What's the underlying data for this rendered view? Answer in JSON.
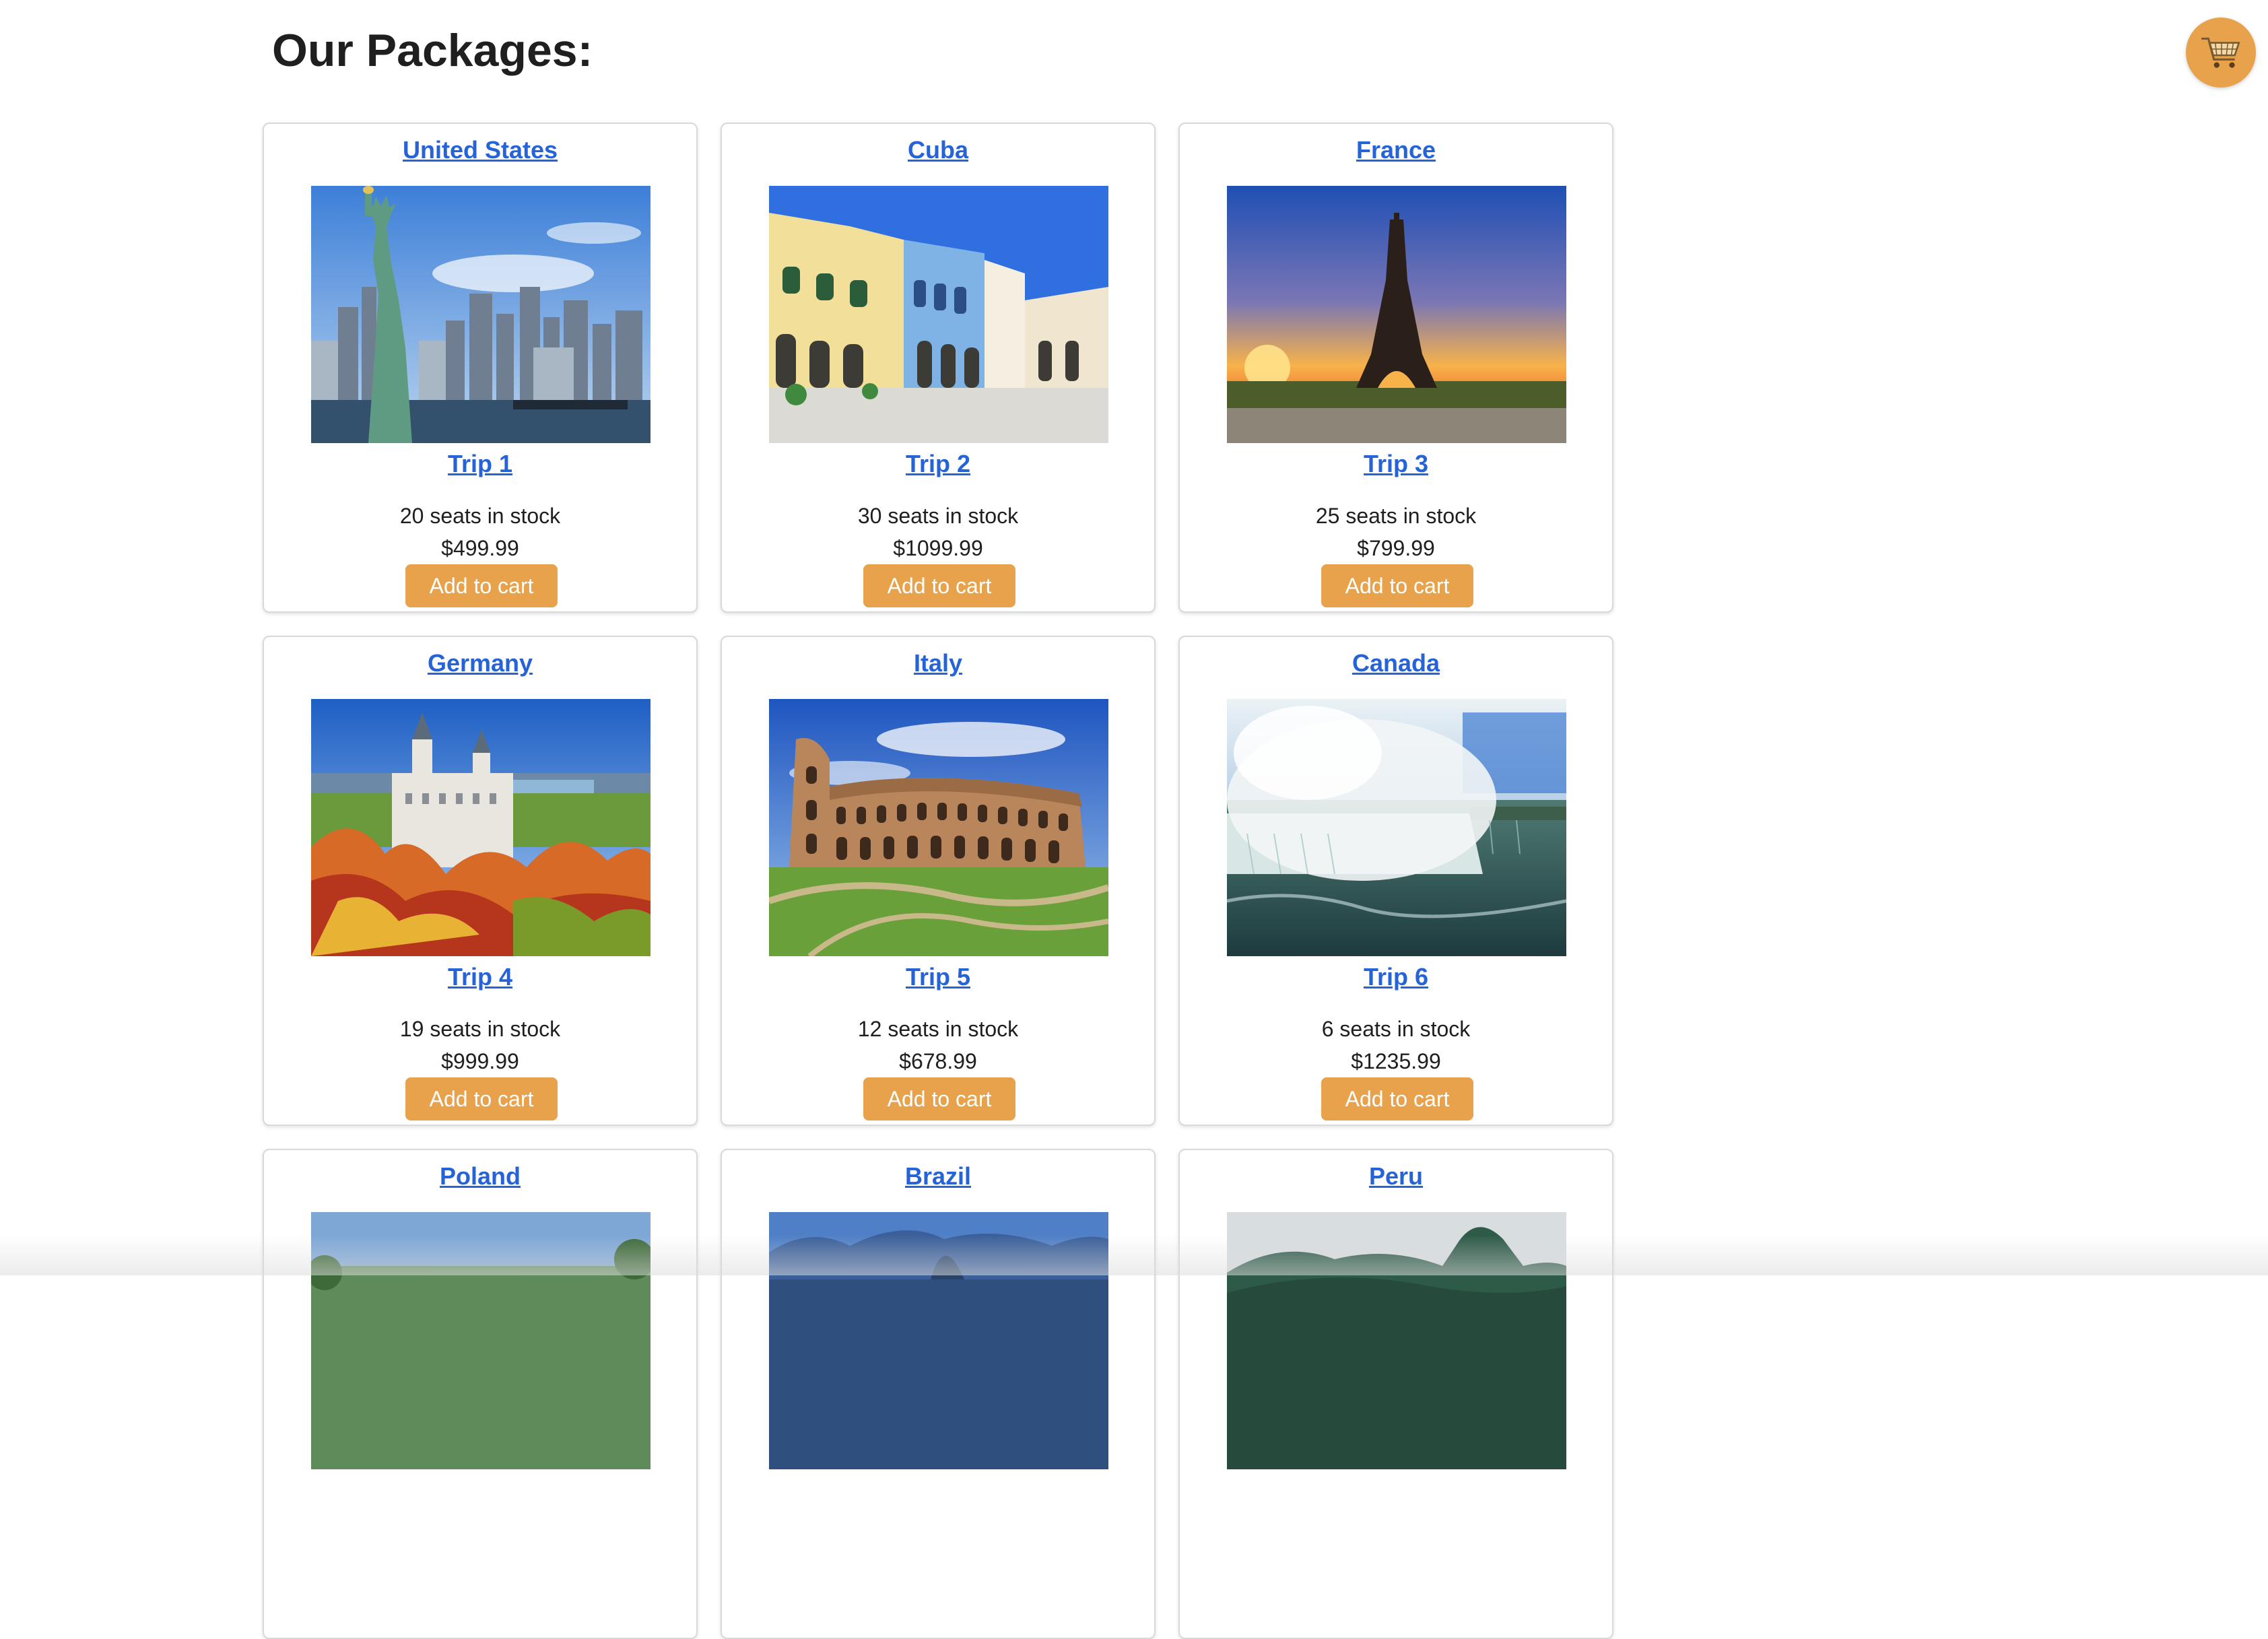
{
  "page": {
    "title": "Our Packages:"
  },
  "cart": {
    "icon": "shopping-cart-icon",
    "color": "#e8a24c"
  },
  "colors": {
    "accent": "#e8a24c",
    "link": "#2563d6"
  },
  "packages": [
    {
      "country": "United States",
      "trip": "Trip 1",
      "stock": "20 seats in stock",
      "price": "$499.99",
      "button": "Add to cart",
      "image": "statue-of-liberty-new-york-skyline"
    },
    {
      "country": "Cuba",
      "trip": "Trip 2",
      "stock": "30 seats in stock",
      "price": "$1099.99",
      "button": "Add to cart",
      "image": "colorful-colonial-buildings-plaza"
    },
    {
      "country": "France",
      "trip": "Trip 3",
      "stock": "25 seats in stock",
      "price": "$799.99",
      "button": "Add to cart",
      "image": "eiffel-tower-sunset"
    },
    {
      "country": "Germany",
      "trip": "Trip 4",
      "stock": "19 seats in stock",
      "price": "$999.99",
      "button": "Add to cart",
      "image": "neuschwanstein-castle-autumn"
    },
    {
      "country": "Italy",
      "trip": "Trip 5",
      "stock": "12 seats in stock",
      "price": "$678.99",
      "button": "Add to cart",
      "image": "colosseum-rome"
    },
    {
      "country": "Canada",
      "trip": "Trip 6",
      "stock": "6 seats in stock",
      "price": "$1235.99",
      "button": "Add to cart",
      "image": "niagara-falls"
    },
    {
      "country": "Poland",
      "image": "poland-landscape"
    },
    {
      "country": "Brazil",
      "image": "rio-de-janeiro-bay"
    },
    {
      "country": "Peru",
      "image": "machu-picchu-mountains"
    }
  ]
}
